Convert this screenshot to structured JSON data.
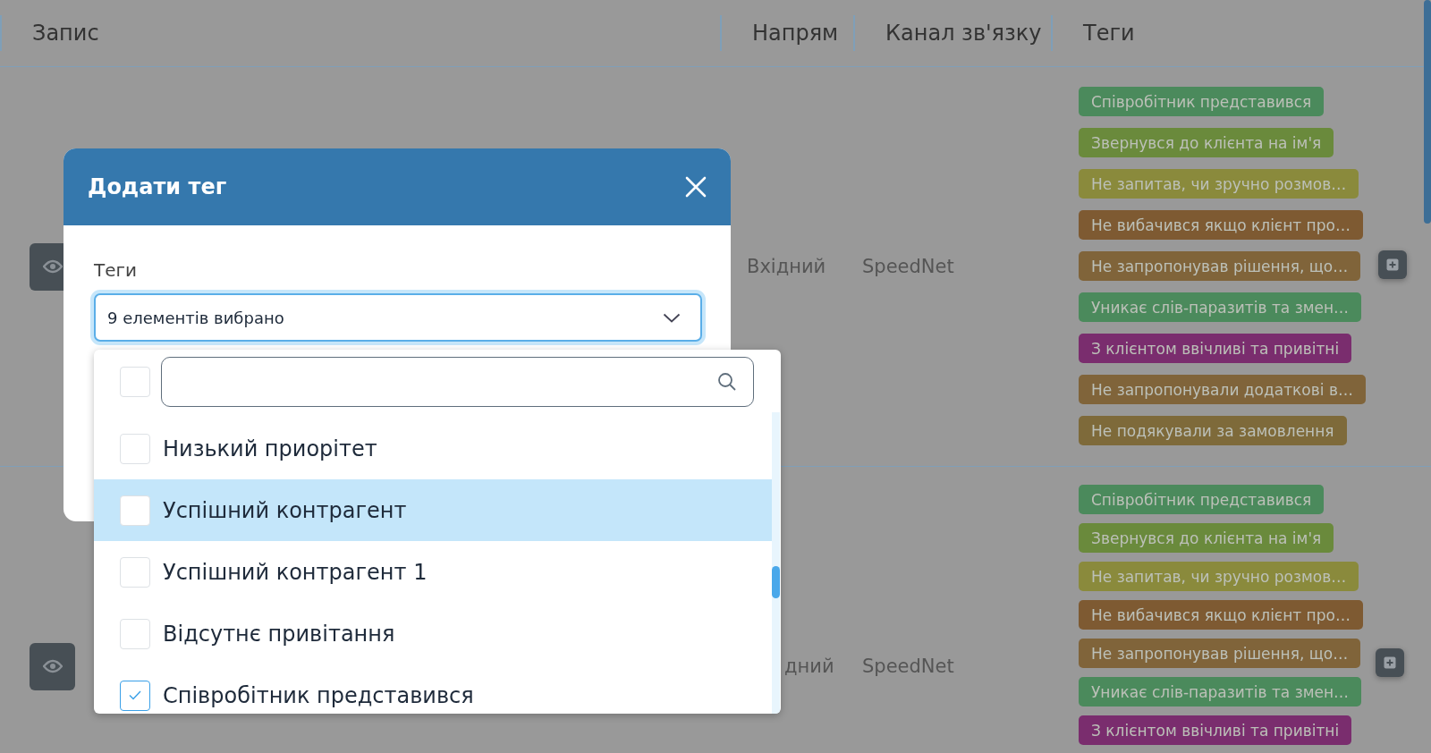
{
  "table": {
    "columns": [
      "Запис",
      "Напрям",
      "Канал зв'язку",
      "Теги"
    ],
    "rows": [
      {
        "direction": "Вхідний",
        "channel": "SpeedNet",
        "tags": [
          {
            "label": "Співробітник представився",
            "color": "#4b8a5c"
          },
          {
            "label": "Звернувся до клієнта на ім'я",
            "color": "#6a8a3c"
          },
          {
            "label": "Не запитав, чи зручно розмов…",
            "color": "#8a8a3c"
          },
          {
            "label": "Не вибачився якщо клієнт про…",
            "color": "#7e5a32"
          },
          {
            "label": "Не запропонував рішення, що…",
            "color": "#80643a"
          },
          {
            "label": "Уникає слів-паразитів та змен…",
            "color": "#4b8a5c"
          },
          {
            "label": "З клієнтом ввічливі та привітні",
            "color": "#7a2d6e"
          },
          {
            "label": "Не запропонували додаткові в…",
            "color": "#80643a"
          },
          {
            "label": "Не подякували за замовлення",
            "color": "#7e6a3a"
          }
        ]
      },
      {
        "direction": "дний",
        "channel": "SpeedNet",
        "tags": [
          {
            "label": "Співробітник представився",
            "color": "#4b8a5c"
          },
          {
            "label": "Звернувся до клієнта на ім'я",
            "color": "#6a8a3c"
          },
          {
            "label": "Не запитав, чи зручно розмов…",
            "color": "#8a8a3c"
          },
          {
            "label": "Не вибачився якщо клієнт про…",
            "color": "#7e5a32"
          },
          {
            "label": "Не запропонував рішення, що…",
            "color": "#80643a"
          },
          {
            "label": "Уникає слів-паразитів та змен…",
            "color": "#4b8a5c"
          },
          {
            "label": "З клієнтом ввічливі та привітні",
            "color": "#7a2d6e"
          }
        ]
      }
    ]
  },
  "modal": {
    "title": "Додати тег",
    "field_label": "Теги",
    "select_value": "9 елементів вибрано",
    "dropdown": {
      "select_all_checked": false,
      "items": [
        {
          "label": "Низький приорітет",
          "checked": false,
          "highlighted": false
        },
        {
          "label": "Успішний контрагент",
          "checked": false,
          "highlighted": true
        },
        {
          "label": "Успішний контрагент 1",
          "checked": false,
          "highlighted": false
        },
        {
          "label": "Відсутнє привітання",
          "checked": false,
          "highlighted": false
        },
        {
          "label": "Співробітник представився",
          "checked": true,
          "highlighted": false
        }
      ]
    }
  }
}
